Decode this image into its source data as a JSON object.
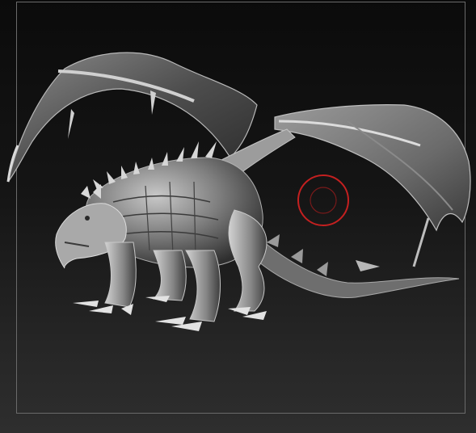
{
  "viewport": {
    "model_name": "",
    "material_color": "#9a9a9a",
    "background_top": "#0b0b0b",
    "background_bottom": "#2e2e2e",
    "frame_color": "#6a6a6a"
  },
  "brush_cursor": {
    "color": "#c42020"
  }
}
